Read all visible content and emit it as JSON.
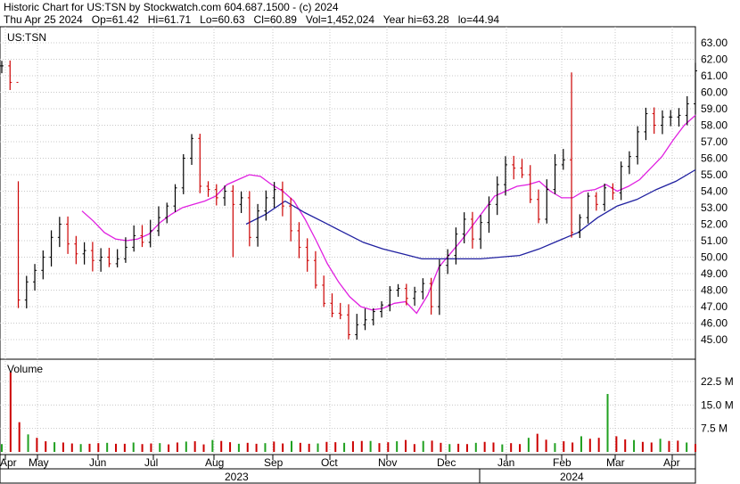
{
  "header": {
    "title": "Historic Chart for US:TSN by Stockwatch.com 604.687.1500 - (c) 2024",
    "quote": "Thu Apr 25 2024   Op=61.42   Hi=61.71   Lo=60.63   Cl=60.89   Vol=1,452,024   Year hi=63.28   lo=44.94"
  },
  "chart_data": [
    {
      "type": "ohlc",
      "symbol_label": "US:TSN",
      "y_ticks": [
        "63.00",
        "62.00",
        "61.00",
        "60.00",
        "59.00",
        "58.00",
        "57.00",
        "56.00",
        "55.00",
        "54.00",
        "53.00",
        "52.00",
        "51.00",
        "50.00",
        "49.00",
        "48.00",
        "47.00",
        "46.00",
        "45.00"
      ],
      "ylim": [
        44.4,
        63.6
      ],
      "x_months": [
        "Apr",
        "May",
        "Jun",
        "Jul",
        "Aug",
        "Sep",
        "Oct",
        "Nov",
        "Dec",
        "Jan",
        "Feb",
        "Mar",
        "Apr"
      ],
      "x_years": [
        "2023",
        "2024"
      ],
      "closes_approx": [
        61.6,
        60.6,
        47.4,
        48.5,
        49.2,
        50.0,
        51.2,
        52.0,
        50.8,
        50.2,
        50.4,
        49.8,
        50.0,
        49.6,
        49.9,
        50.6,
        51.3,
        50.9,
        51.6,
        52.4,
        53.1,
        54.2,
        56.0,
        57.2,
        54.3,
        54.1,
        53.6,
        54.0,
        53.2,
        53.6,
        51.2,
        52.8,
        53.6,
        54.1,
        53.1,
        51.6,
        50.6,
        49.8,
        48.3,
        47.2,
        46.6,
        46.5,
        45.3,
        45.9,
        46.2,
        46.7,
        47.1,
        48.0,
        48.1,
        47.5,
        47.9,
        48.4,
        47.0,
        49.5,
        50.1,
        51.4,
        52.3,
        51.1,
        52.1,
        53.2,
        54.4,
        55.6,
        55.4,
        55.0,
        53.5,
        52.3,
        54.1,
        55.6,
        55.9,
        51.5,
        52.4,
        53.7,
        53.2,
        54.2,
        53.9,
        55.5,
        56.1,
        57.6,
        58.7,
        58.0,
        58.5,
        58.5,
        58.6,
        59.3,
        61.3
      ],
      "moving_averages": [
        {
          "color": "#e020e0",
          "values": [
            52.8,
            52.2,
            51.5,
            51.1,
            51.0,
            51.1,
            51.4,
            52.1,
            52.6,
            53.0,
            53.2,
            53.4,
            53.7,
            54.4,
            54.7,
            55.0,
            54.9,
            54.4,
            54.0,
            53.4,
            52.3,
            51.0,
            49.6,
            48.5,
            47.6,
            47.0,
            46.8,
            46.9,
            47.2,
            47.3,
            46.6,
            47.7,
            49.4,
            50.2,
            51.0,
            51.9,
            52.8,
            53.7,
            54.0,
            54.3,
            54.4,
            54.6,
            54.0,
            53.6,
            53.6,
            54.0,
            54.1,
            54.4,
            54.0,
            54.3,
            54.7,
            55.4,
            56.1,
            57.1,
            58.0,
            58.6
          ]
        },
        {
          "color": "#2020a0",
          "values": [
            52.0,
            52.6,
            53.4,
            52.7,
            52.1,
            51.5,
            50.9,
            50.5,
            50.2,
            49.9,
            49.9,
            49.9,
            49.9,
            50.0,
            50.1,
            50.5,
            51.0,
            51.5,
            52.4,
            53.1,
            53.5,
            54.1,
            54.6,
            55.3
          ]
        }
      ],
      "volume": {
        "label": "Volume",
        "y_ticks": [
          "22.5 M",
          "15.0 M",
          "7.5 M"
        ],
        "ylim": [
          0,
          30
        ],
        "units": "M",
        "values_approx": [
          2.5,
          25.5,
          9.5,
          5.6,
          4.5,
          3.4,
          3.1,
          3.0,
          2.7,
          2.5,
          2.6,
          2.8,
          2.9,
          2.6,
          2.6,
          3.0,
          2.5,
          2.7,
          2.8,
          2.4,
          3.0,
          3.3,
          3.4,
          2.4,
          3.8,
          3.5,
          3.1,
          2.6,
          2.9,
          2.6,
          2.8,
          3.3,
          2.7,
          3.5,
          2.9,
          2.6,
          2.7,
          3.2,
          3.1,
          2.9,
          3.4,
          3.5,
          3.5,
          2.8,
          3.1,
          3.4,
          3.8,
          2.5,
          3.5,
          3.6,
          2.9,
          2.5,
          2.6,
          2.5,
          2.9,
          3.2,
          3.0,
          2.4,
          2.8,
          2.5,
          4.5,
          5.8,
          3.9,
          2.8,
          3.4,
          3.0,
          5.0,
          4.2,
          4.5,
          18.5,
          5.0,
          4.0,
          3.8,
          3.2,
          3.0,
          4.2,
          3.5,
          3.6,
          3.0,
          2.5
        ]
      }
    }
  ]
}
